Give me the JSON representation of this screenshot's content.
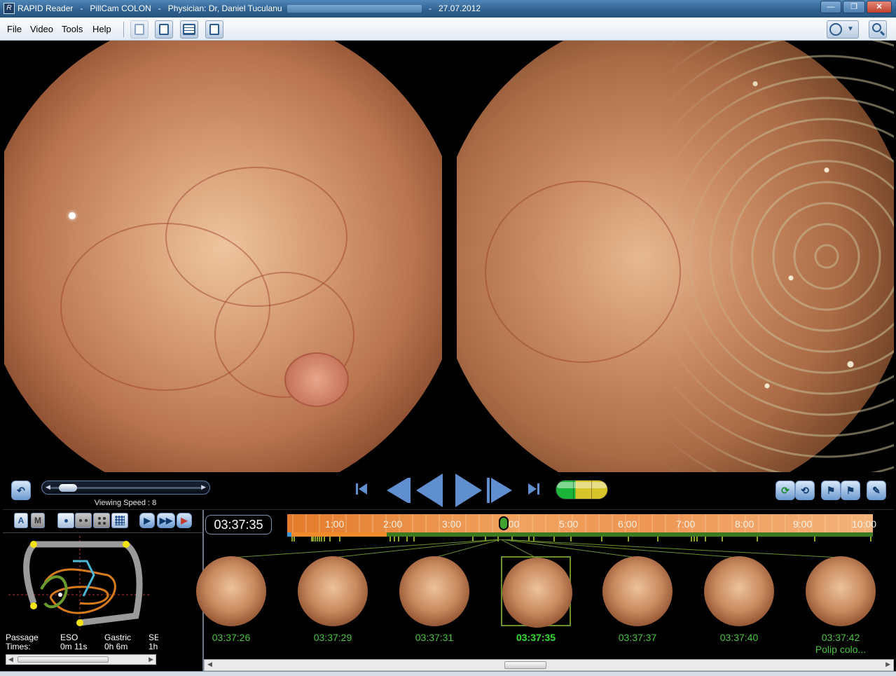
{
  "window": {
    "app_name": "RAPID Reader",
    "separator": "-",
    "product": "PillCam COLON",
    "physician": "Physician: Dr, Daniel Tuculanu",
    "date": "27.07.2012",
    "app_icon_letter": "R"
  },
  "window_buttons": {
    "minimize": "—",
    "maximize": "❐",
    "close": "✕"
  },
  "menu": {
    "file": "File",
    "video": "Video",
    "tools": "Tools",
    "help": "Help"
  },
  "toolbar": {
    "view_dropdown_arrow": "▼",
    "view_icon": "compass-icon",
    "search_icon": "magnifier-icon"
  },
  "playback": {
    "viewing_speed_label": "Viewing Speed : 8",
    "viewing_speed": 8,
    "speed_thumb_fraction": 0.05,
    "indicator_colors": [
      "#1bb53a",
      "#d6c42a"
    ]
  },
  "modes": {
    "auto": "A",
    "manual": "M"
  },
  "timeline": {
    "current_time": "03:37:35",
    "ticks": [
      "1:00",
      "2:00",
      "3:00",
      "4:00",
      "5:00",
      "6:00",
      "7:00",
      "8:00",
      "9:00",
      "10:00"
    ],
    "cursor_fraction": 0.37
  },
  "passage": {
    "label_line1": "Passage",
    "label_line2": "Times:",
    "eso_label": "ESO",
    "eso_value": "0m 11s",
    "gastric_label": "Gastric",
    "gastric_value": "0h 6m",
    "sb_label": "SE",
    "sb_value": "1h"
  },
  "thumbnails": [
    {
      "time": "03:37:26",
      "selected": false,
      "caption": ""
    },
    {
      "time": "03:37:29",
      "selected": false,
      "caption": ""
    },
    {
      "time": "03:37:31",
      "selected": false,
      "caption": ""
    },
    {
      "time": "03:37:35",
      "selected": true,
      "caption": ""
    },
    {
      "time": "03:37:37",
      "selected": false,
      "caption": ""
    },
    {
      "time": "03:37:40",
      "selected": false,
      "caption": ""
    },
    {
      "time": "03:37:42",
      "selected": false,
      "caption": "Polip colo..."
    }
  ],
  "colors": {
    "accent": "#5f8fcf",
    "thumb_time": "#49c33f",
    "timebar": "#e37a2b"
  }
}
